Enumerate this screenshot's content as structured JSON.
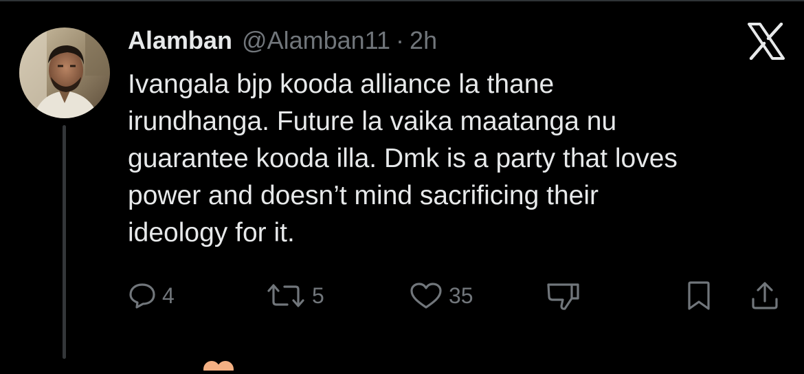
{
  "colors": {
    "background": "#000000",
    "text_primary": "#e7e9ea",
    "text_secondary": "#71767b",
    "divider": "#2f3336",
    "thread_line": "#333639"
  },
  "tweet": {
    "author_name": "Alamban",
    "author_handle": "@Alamban11",
    "separator": "·",
    "time": "2h",
    "text": "Ivangala bjp kooda alliance la thane\nirundhanga. Future la vaika maatanga nu\nguarantee kooda illa. Dmk is a party that loves\npower and doesn’t mind sacrificing their\nideology for it."
  },
  "actions": {
    "reply": {
      "icon": "reply-icon",
      "count": "4"
    },
    "repost": {
      "icon": "repost-icon",
      "count": "5"
    },
    "like": {
      "icon": "heart-icon",
      "count": "35"
    },
    "downvote": {
      "icon": "thumbs-down-icon"
    },
    "bookmark": {
      "icon": "bookmark-icon"
    },
    "share": {
      "icon": "share-icon"
    }
  },
  "brand": {
    "icon": "x-logo-icon"
  }
}
